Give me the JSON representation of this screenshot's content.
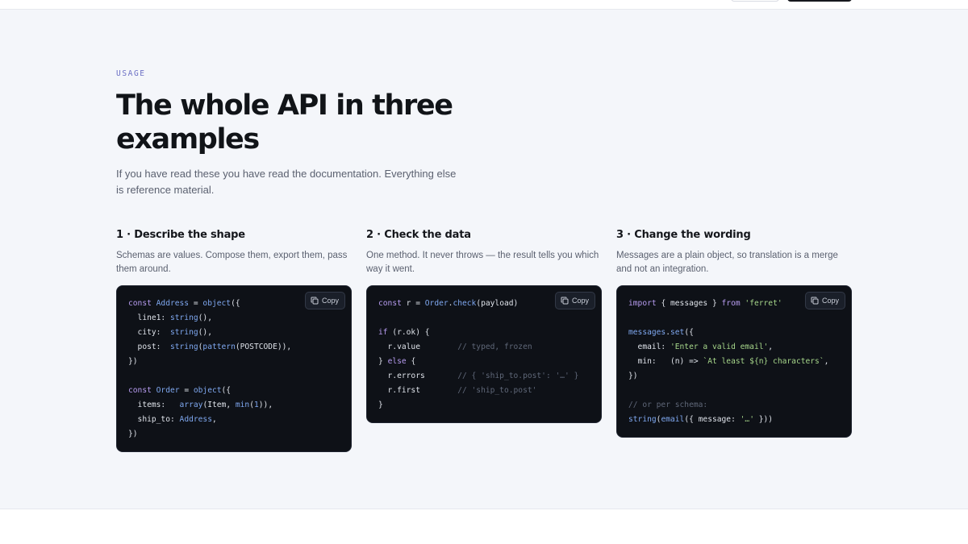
{
  "section": {
    "eyebrow": "USAGE",
    "title": "The whole API in three examples",
    "lede": "If you have read these you have read the documentation. Everything else is reference material."
  },
  "examples": [
    {
      "title": "1 · Describe the shape",
      "description": "Schemas are values. Compose them, export them, pass them around.",
      "copy_label": "Copy",
      "code_lines": [
        [
          [
            "kw",
            "const "
          ],
          [
            "fn",
            "Address"
          ],
          [
            "pl",
            " = "
          ],
          [
            "fn",
            "object"
          ],
          [
            "pl",
            "({"
          ]
        ],
        [
          [
            "pl",
            "  line1: "
          ],
          [
            "fn",
            "string"
          ],
          [
            "pl",
            "(),"
          ]
        ],
        [
          [
            "pl",
            "  city:  "
          ],
          [
            "fn",
            "string"
          ],
          [
            "pl",
            "(),"
          ]
        ],
        [
          [
            "pl",
            "  post:  "
          ],
          [
            "fn",
            "string"
          ],
          [
            "pl",
            "("
          ],
          [
            "fn",
            "pattern"
          ],
          [
            "pl",
            "(POSTCODE)),"
          ]
        ],
        [
          [
            "pl",
            "})"
          ]
        ],
        [],
        [
          [
            "kw",
            "const "
          ],
          [
            "fn",
            "Order"
          ],
          [
            "pl",
            " = "
          ],
          [
            "fn",
            "object"
          ],
          [
            "pl",
            "({"
          ]
        ],
        [
          [
            "pl",
            "  items:   "
          ],
          [
            "fn",
            "array"
          ],
          [
            "pl",
            "(Item, "
          ],
          [
            "fn",
            "min"
          ],
          [
            "pl",
            "("
          ],
          [
            "num",
            "1"
          ],
          [
            "pl",
            ")),"
          ]
        ],
        [
          [
            "pl",
            "  ship_to: "
          ],
          [
            "fn",
            "Address"
          ],
          [
            "pl",
            ","
          ]
        ],
        [
          [
            "pl",
            "})"
          ]
        ]
      ]
    },
    {
      "title": "2 · Check the data",
      "description": "One method. It never throws — the result tells you which way it went.",
      "copy_label": "Copy",
      "code_lines": [
        [
          [
            "kw",
            "const "
          ],
          [
            "pl",
            "r = "
          ],
          [
            "fn",
            "Order"
          ],
          [
            "pl",
            "."
          ],
          [
            "fn",
            "check"
          ],
          [
            "pl",
            "(payload)"
          ]
        ],
        [],
        [
          [
            "kw",
            "if "
          ],
          [
            "pl",
            "(r.ok) {"
          ]
        ],
        [
          [
            "pl",
            "  r.value        "
          ],
          [
            "cm",
            "// typed, frozen"
          ]
        ],
        [
          [
            "pl",
            "} "
          ],
          [
            "kw",
            "else"
          ],
          [
            "pl",
            " {"
          ]
        ],
        [
          [
            "pl",
            "  r.errors       "
          ],
          [
            "cm",
            "// { 'ship_to.post': '…' }"
          ]
        ],
        [
          [
            "pl",
            "  r.first        "
          ],
          [
            "cm",
            "// 'ship_to.post'"
          ]
        ],
        [
          [
            "pl",
            "}"
          ]
        ]
      ]
    },
    {
      "title": "3 · Change the wording",
      "description": "Messages are a plain object, so translation is a merge and not an integration.",
      "copy_label": "Copy",
      "code_lines": [
        [
          [
            "kw",
            "import "
          ],
          [
            "pl",
            "{ messages } "
          ],
          [
            "kw",
            "from "
          ],
          [
            "str",
            "'ferret'"
          ]
        ],
        [],
        [
          [
            "fn",
            "messages"
          ],
          [
            "pl",
            "."
          ],
          [
            "fn",
            "set"
          ],
          [
            "pl",
            "({"
          ]
        ],
        [
          [
            "pl",
            "  email: "
          ],
          [
            "str",
            "'Enter a valid email'"
          ],
          [
            "pl",
            ","
          ]
        ],
        [
          [
            "pl",
            "  min:   (n) => "
          ],
          [
            "str",
            "`At least ${n} characters`"
          ],
          [
            "pl",
            ","
          ]
        ],
        [
          [
            "pl",
            "})"
          ]
        ],
        [],
        [
          [
            "cm",
            "// or per schema:"
          ]
        ],
        [
          [
            "fn",
            "string"
          ],
          [
            "pl",
            "("
          ],
          [
            "fn",
            "email"
          ],
          [
            "pl",
            "({ message: "
          ],
          [
            "str",
            "'…'"
          ],
          [
            "pl",
            " }))"
          ]
        ]
      ]
    }
  ],
  "colors": {
    "section_bg": "#f4f6fa",
    "code_bg": "#0e1117",
    "eyebrow": "#6b6fc4",
    "keyword": "#b79cf0",
    "function": "#7fa8f0",
    "string": "#a6d68a",
    "comment": "#5f6778"
  },
  "icons": {
    "copy": "copy-icon"
  }
}
